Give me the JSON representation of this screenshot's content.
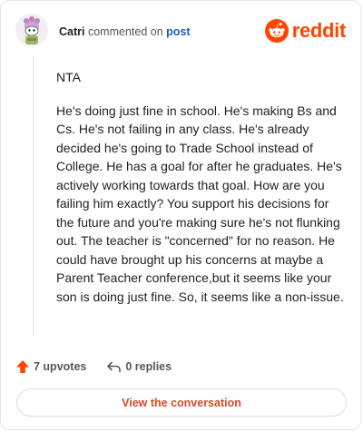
{
  "header": {
    "username": "Catri",
    "commented_on": "commented on",
    "post_link": "post",
    "brand_name": "reddit"
  },
  "comment": {
    "verdict": "NTA",
    "text": "He's doing just fine in school. He's making Bs and Cs. He's not failing in any class. He's already decided he's going to Trade School instead of College. He has a goal for after he graduates. He's actively working towards that goal. How are you failing him exactly? You support his decisions for the future and you're making sure he's not flunking out. The teacher is \"concerned\" for no reason. He could have brought up his concerns at maybe a Parent Teacher conference,but it seems like your son is doing just fine. So, it seems like a non-issue."
  },
  "actions": {
    "upvotes_label": "7 upvotes",
    "replies_label": "0 replies"
  },
  "footer": {
    "view_conversation_label": "View the conversation"
  },
  "icons": {
    "upvote": "upvote-arrow-icon",
    "reply": "reply-arrow-icon",
    "brand": "reddit-logo-icon",
    "avatar": "snoo-avatar-icon"
  },
  "colors": {
    "brand": "#ff4500",
    "post_link": "#1b5fb8",
    "view_conversation": "#d64a24"
  }
}
